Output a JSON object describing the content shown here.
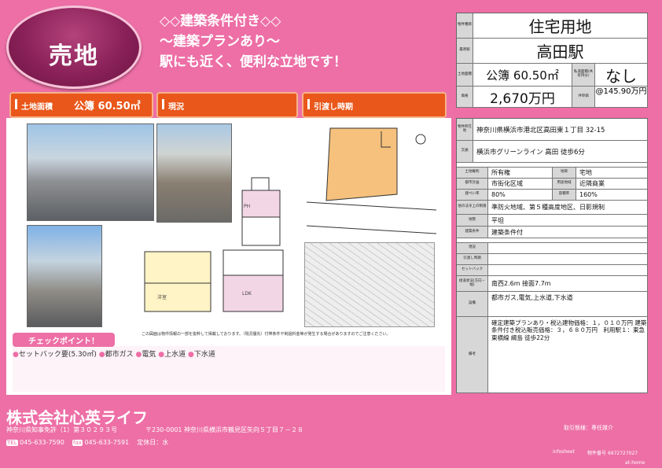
{
  "header": {
    "badge": "売地",
    "headlines": [
      "◇◇建築条件付き◇◇",
      "〜建築プランあり〜",
      "駅にも近く、便利な立地です！"
    ]
  },
  "bars": {
    "land_area_label": "土地面積",
    "land_area_value": "公簿 60.50㎡",
    "status_label": "現況",
    "handover_label": "引渡し時期"
  },
  "summary": {
    "type_label": "物件種目",
    "type": "住宅用地",
    "station_label": "最寄駅",
    "station": "高田駅",
    "area_label": "土地面積",
    "area": "公簿 60.50㎡",
    "private_road_label": "私道面積(共有持分)",
    "private_road": "なし",
    "price_label": "価格",
    "price": "2,670万円",
    "unit_label": "坪単価",
    "unit_price": "@145.90万円"
  },
  "details": {
    "address_label": "物件所在地",
    "address": "神奈川県横浜市港北区高田東１丁目 32-15",
    "traffic_label": "交通",
    "traffic": "横浜市グリーンライン 高田 徒歩6分",
    "rights_label": "土地権利",
    "rights": "所有権",
    "land_cat_label": "地目",
    "land_cat": "宅地",
    "city_plan_label": "都市計画",
    "city_plan": "市街化区域",
    "zoning_label": "用途地域",
    "zoning": "近隣商業",
    "bcr_label": "建ぺい率",
    "bcr": "80%",
    "far_label": "容積率",
    "far": "160%",
    "legal_label": "他の法令上の制限",
    "legal": "準防火地域、第５種高度地区、日影規制",
    "terrain_label": "地勢",
    "terrain": "平坦",
    "condition_label": "建築条件",
    "condition": "建築条件付",
    "current_label": "現況",
    "current": "",
    "handover_label": "引渡し時期",
    "handover": "",
    "setback_label": "セットバック",
    "setback": "",
    "road_label": "接道状況(方向・幅)",
    "road": "南西2.6m 接面7.7m",
    "facilities_label": "設備",
    "facilities": "都市ガス,電気,上水道,下水道",
    "remarks_label": "備考",
    "remarks": "確定建築プランあり・税込建物価格：１，０１０万円 建築条件付き税込販売価格：３，６８０万円　利用駅１：東急東横線 綱島 徒歩22分"
  },
  "main": {
    "note": "この図面は物件情報の一部を抜粋して掲載しております。（現況優先）付帯条件や制過料金等が発生する場合がありますのでご注意ください。",
    "check_title": "チェックポイント！",
    "check_items": [
      "セットバック要(5.30㎡)",
      "都市ガス",
      "電気",
      "上水道",
      "下水道"
    ]
  },
  "footer": {
    "company": "株式会社心英ライフ",
    "license": "神奈川県知事免許（1）第３０２９３号",
    "address": "〒230-0001 神奈川県横浜市鶴見区矢向５丁目７－２８",
    "tel_label": "TEL",
    "tel": "045-633-7590",
    "fax_label": "fax",
    "fax": "045-633-7591",
    "holiday": "定休日：水",
    "deal_label": "取引態様：",
    "deal": "専任媒介",
    "infosheet": "infosheet",
    "property_no_label": "物件番号",
    "property_no": "6972727027",
    "brand": "at-home"
  }
}
